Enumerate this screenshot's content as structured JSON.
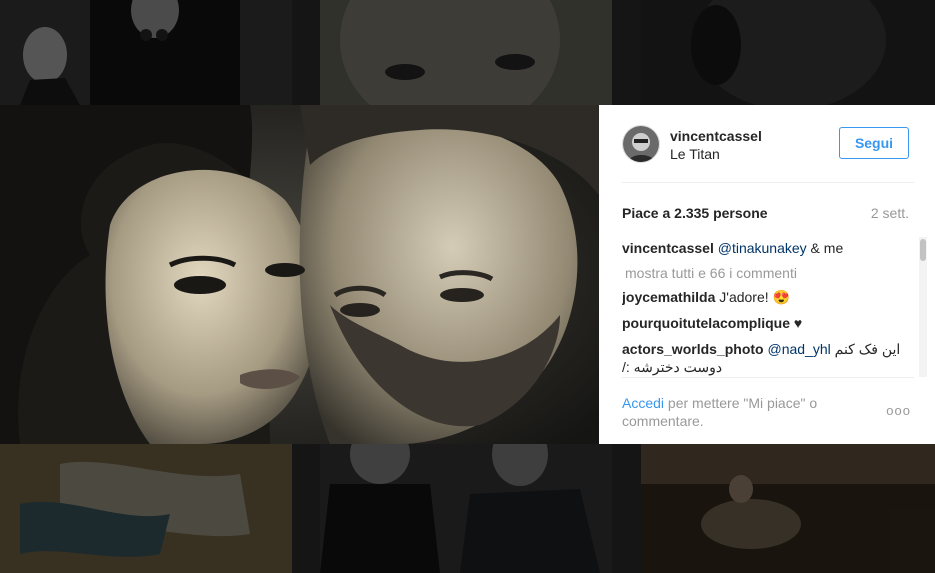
{
  "post": {
    "username": "vincentcassel",
    "location": "Le Titan",
    "follow_label": "Segui",
    "likes_text": "Piace a 2.335 persone",
    "time_ago": "2 sett.",
    "caption": {
      "user": "vincentcassel",
      "mention": "@tinakunakey",
      "text": " & me"
    },
    "view_all_comments": "mostra tutti e 66 i commenti",
    "comments": [
      {
        "user": "joycemathilda",
        "text": "J'adore! 😍"
      },
      {
        "user": "pourquoitutelacomplique",
        "text": "♥"
      },
      {
        "user": "actors_worlds_photo",
        "mention": "@nad_yhl",
        "text": "این فک کنم دوست دخترشه :/"
      }
    ],
    "login_link": "Accedi",
    "login_text": "per mettere \"Mi piace\" o commentare.",
    "more_label": "ooo"
  }
}
